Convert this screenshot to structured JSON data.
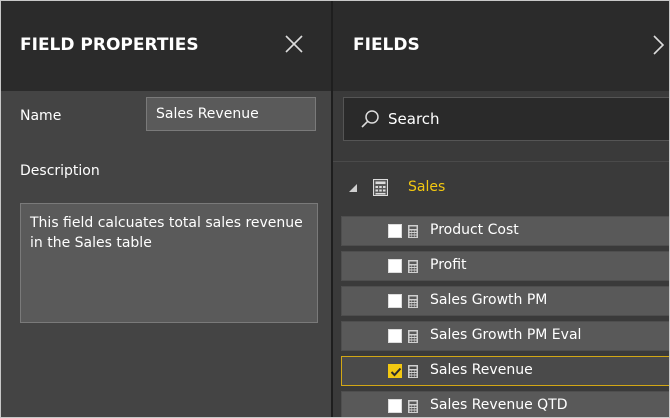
{
  "field_properties": {
    "title": "FIELD PROPERTIES",
    "close_icon": "close-icon",
    "name_label": "Name",
    "name_value": "Sales Revenue",
    "description_label": "Description",
    "description_value": "This field calcuates total sales revenue in the Sales table"
  },
  "fields_pane": {
    "title": "FIELDS",
    "collapse_icon": "chevron-right-icon",
    "search": {
      "placeholder": "Search",
      "icon": "search-icon"
    },
    "group": {
      "label": "Sales",
      "icon": "table-icon",
      "expanded": true
    },
    "items": [
      {
        "label": "Product Cost",
        "checked": false,
        "icon": "calculator-icon"
      },
      {
        "label": "Profit",
        "checked": false,
        "icon": "calculator-icon"
      },
      {
        "label": "Sales Growth PM",
        "checked": false,
        "icon": "calculator-icon"
      },
      {
        "label": "Sales Growth PM Eval",
        "checked": false,
        "icon": "calculator-icon"
      },
      {
        "label": "Sales Revenue",
        "checked": true,
        "icon": "calculator-icon"
      },
      {
        "label": "Sales Revenue QTD",
        "checked": false,
        "icon": "calculator-icon"
      }
    ]
  },
  "colors": {
    "header_bg": "#2b2b2b",
    "pane_bg": "#444444",
    "accent": "#f2c811",
    "text": "#ffffff"
  }
}
